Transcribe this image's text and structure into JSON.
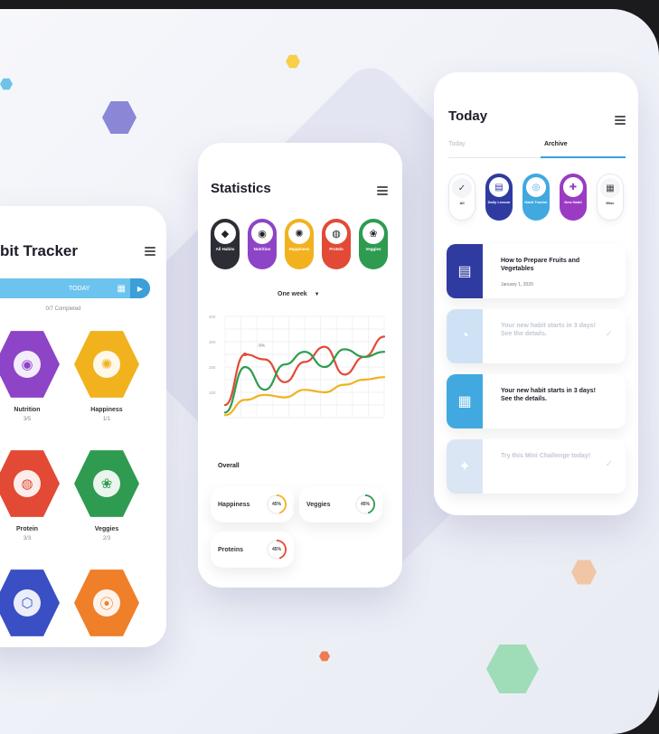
{
  "habit_tracker": {
    "title": "bit Tracker",
    "today_label": "TODAY",
    "completed": "0/7 Completed",
    "habits": [
      {
        "name": "Nutrition",
        "count": "3/5",
        "color": "#8e44c6",
        "icon": "nutrition-icon"
      },
      {
        "name": "Happiness",
        "count": "1/1",
        "color": "#f1b21e",
        "icon": "gear-icon"
      },
      {
        "name": "Protein",
        "count": "3/3",
        "color": "#e24a36",
        "icon": "meat-icon"
      },
      {
        "name": "Veggies",
        "count": "2/3",
        "color": "#2e9b50",
        "icon": "broccoli-icon"
      },
      {
        "name": "",
        "count": "",
        "color": "#3a4fc4",
        "icon": "water-icon"
      },
      {
        "name": "",
        "count": "",
        "color": "#f07f2a",
        "icon": "dumbbell-icon"
      }
    ]
  },
  "statistics": {
    "title": "Statistics",
    "categories": [
      {
        "label": "All Habits",
        "color": "#2d2d35",
        "icon": "all-icon"
      },
      {
        "label": "Nutrition",
        "color": "#8e44c6",
        "icon": "nutrition-icon"
      },
      {
        "label": "Happiness",
        "color": "#f1b21e",
        "icon": "gear-icon"
      },
      {
        "label": "Protein",
        "color": "#e24a36",
        "icon": "meat-icon"
      },
      {
        "label": "Veggies",
        "color": "#2e9b50",
        "icon": "broccoli-icon"
      }
    ],
    "range_label": "One week",
    "y_ticks": [
      "400",
      "300",
      "200",
      "100"
    ],
    "point_label": "-5%",
    "overall_label": "Overall",
    "overall": [
      {
        "name": "Happiness",
        "value": "45%",
        "color": "#f1b21e",
        "percent": 45
      },
      {
        "name": "Veggies",
        "value": "45%",
        "color": "#2e9b50",
        "percent": 45
      },
      {
        "name": "Proteins",
        "value": "45%",
        "color": "#e24a36",
        "percent": 45
      }
    ]
  },
  "chart_data": {
    "type": "line",
    "x": [
      0,
      1,
      2,
      3,
      4,
      5,
      6,
      7,
      8
    ],
    "ylim": [
      0,
      400
    ],
    "series": [
      {
        "values": [
          50,
          250,
          230,
          140,
          220,
          280,
          170,
          240,
          320
        ],
        "color": "#e24a36"
      },
      {
        "values": [
          20,
          200,
          110,
          210,
          260,
          200,
          270,
          240,
          260
        ],
        "color": "#2e9b50"
      },
      {
        "values": [
          10,
          70,
          90,
          80,
          110,
          100,
          130,
          150,
          160
        ],
        "color": "#f1b21e"
      }
    ],
    "grid": true
  },
  "today": {
    "title": "Today",
    "tabs": [
      "Today",
      "Archive"
    ],
    "categories": [
      {
        "label": "All",
        "color": "#ffffff",
        "text": "#333333",
        "icon": "check-icon"
      },
      {
        "label": "Daily Lesson",
        "color": "#2f3ba0",
        "text": "#ffffff",
        "icon": "book-icon"
      },
      {
        "label": "Habit Tracker",
        "color": "#41a9e0",
        "text": "#ffffff",
        "icon": "tracker-icon"
      },
      {
        "label": "New Habit",
        "color": "#9b3bc4",
        "text": "#ffffff",
        "icon": "new-icon"
      },
      {
        "label": "Misc",
        "color": "#ffffff",
        "text": "#333333",
        "icon": "grid-icon"
      }
    ],
    "items": [
      {
        "title": "How to Prepare Fruits and Vegetables",
        "date": "January 1, 2020",
        "color": "#2f3ba0",
        "faded": false,
        "icon": "book-icon"
      },
      {
        "title": "Your new habit starts in 3 days! See the details.",
        "date": "",
        "color": "#cfe2f5",
        "faded": true,
        "icon": "timer-icon"
      },
      {
        "title": "Your new habit starts in 3 days! See the details.",
        "date": "",
        "color": "#41a9e0",
        "faded": false,
        "icon": "calendar-icon"
      },
      {
        "title": "Try this Mini Challenge today!",
        "date": "",
        "color": "#dbe6f4",
        "faded": true,
        "icon": "challenge-icon"
      }
    ]
  }
}
